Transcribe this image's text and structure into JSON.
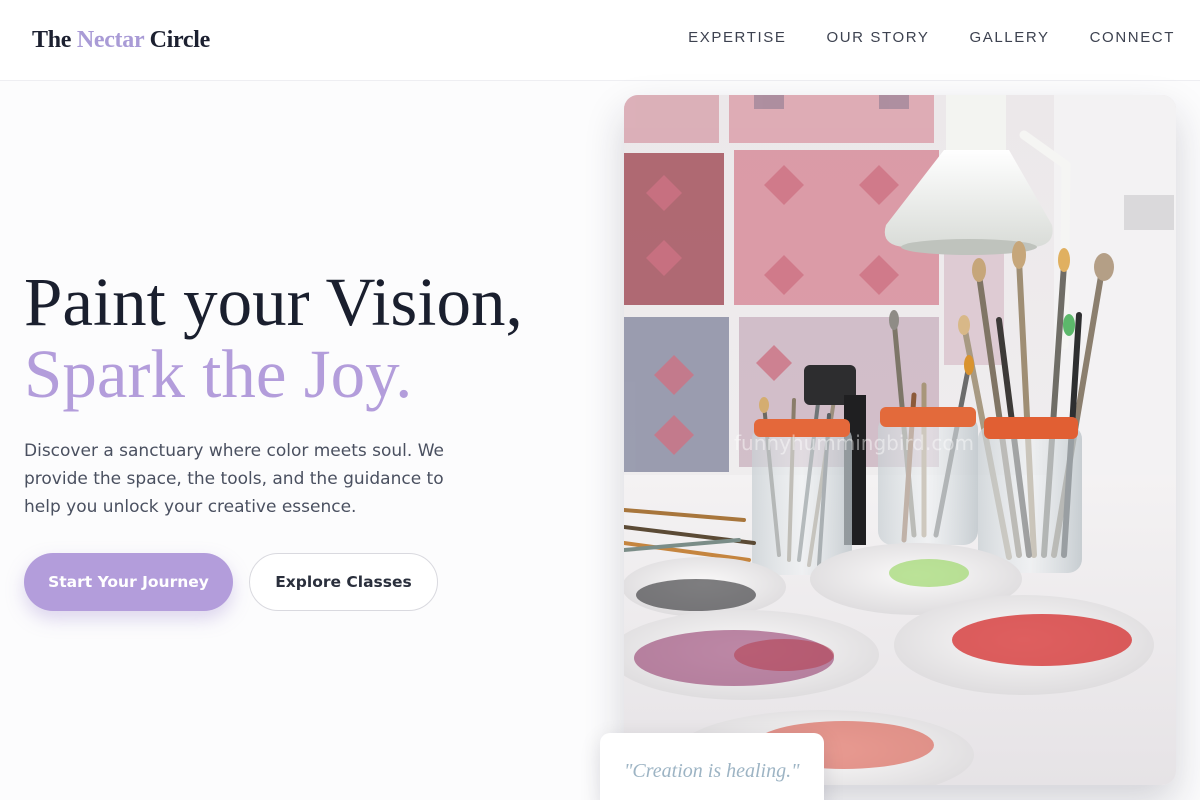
{
  "brand": {
    "prefix": "The",
    "accent": "Nectar",
    "suffix": "Circle",
    "accent_color": "#a99bd6"
  },
  "nav": {
    "items": [
      {
        "label": "EXPERTISE"
      },
      {
        "label": "OUR STORY"
      },
      {
        "label": "GALLERY"
      },
      {
        "label": "CONNECT"
      }
    ]
  },
  "hero": {
    "headline_line1": "Paint your Vision,",
    "headline_line2": "Spark the Joy.",
    "headline_accent_color": "#b39ddb",
    "description": "Discover a sanctuary where color meets soul. We provide the space, the tools, and the guidance to help you unlock your creative essence.",
    "primary_cta": "Start Your Journey",
    "primary_cta_color": "#b39ddb",
    "secondary_cta": "Explore Classes"
  },
  "image": {
    "icon": "art-studio-photo",
    "watermark": "funnyhummingbird.com"
  },
  "quote": {
    "text": "\"Creation is healing.\""
  }
}
